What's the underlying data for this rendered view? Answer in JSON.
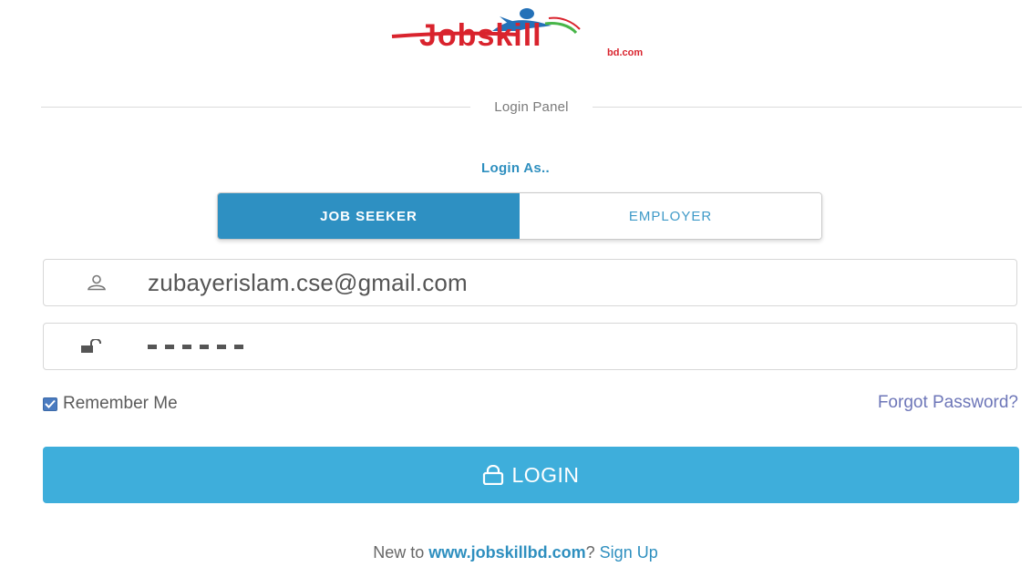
{
  "logo": {
    "text": "Jobskill",
    "subtext": "bd.com",
    "colors": {
      "red": "#d9232d",
      "blue": "#2471b8",
      "green": "#47b548"
    }
  },
  "panel": {
    "title": "Login Panel"
  },
  "login_as": {
    "label": "Login As..",
    "roles": [
      {
        "label": "JOB SEEKER",
        "active": true
      },
      {
        "label": "EMPLOYER",
        "active": false
      }
    ]
  },
  "email_field": {
    "value": "zubayerislam.cse@gmail.com",
    "icon": "user-icon"
  },
  "password_field": {
    "masked_length": 6,
    "icon": "unlock-icon"
  },
  "remember": {
    "label": "Remember Me",
    "checked": true
  },
  "forgot": {
    "label": "Forgot Password?"
  },
  "login_button": {
    "label": "LOGIN",
    "icon": "lock-icon"
  },
  "signup": {
    "prefix": "New to ",
    "site": "www.jobskillbd.com",
    "separator": "? ",
    "link": "Sign Up"
  },
  "colors": {
    "accent": "#2e90c2",
    "button": "#3eaedb",
    "link_purple": "#6d76b8"
  }
}
